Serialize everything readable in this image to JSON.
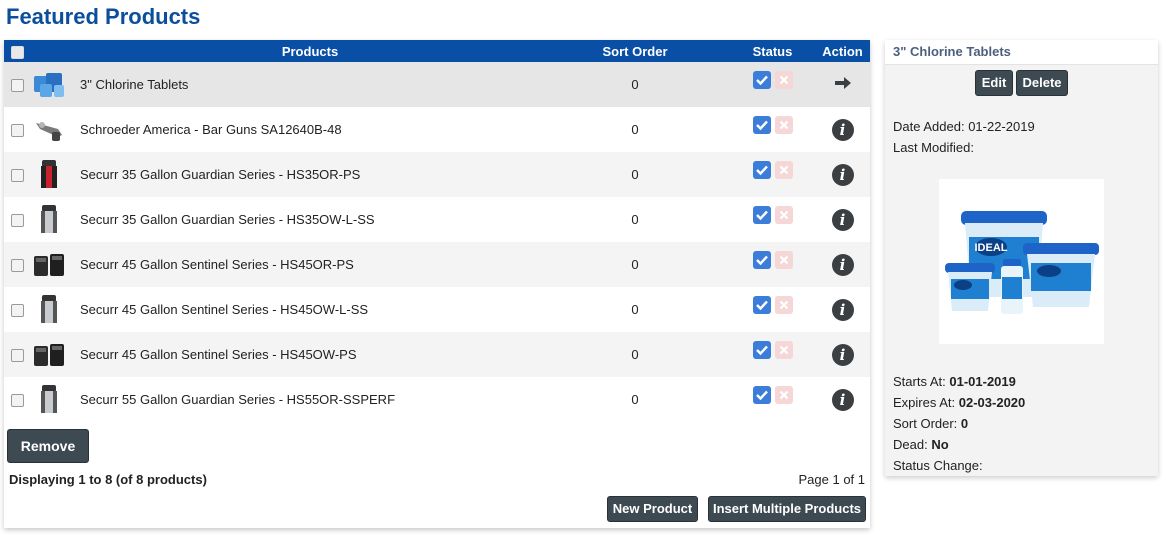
{
  "page": {
    "title": "Featured Products"
  },
  "table": {
    "headers": {
      "products": "Products",
      "sort_order": "Sort Order",
      "status": "Status",
      "action": "Action"
    },
    "rows": [
      {
        "name": "3\" Chlorine Tablets",
        "sort_order": "0",
        "image": "chlorine-tablets-image",
        "action_icon": "arrow-right-icon"
      },
      {
        "name": "Schroeder America - Bar Guns SA12640B-48",
        "sort_order": "0",
        "image": "bar-gun-image",
        "action_icon": "info-icon"
      },
      {
        "name": "Securr 35 Gallon Guardian Series - HS35OR-PS",
        "sort_order": "0",
        "image": "trash-can-red-image",
        "action_icon": "info-icon"
      },
      {
        "name": "Securr 35 Gallon Guardian Series - HS35OW-L-SS",
        "sort_order": "0",
        "image": "trash-can-steel-image",
        "action_icon": "info-icon"
      },
      {
        "name": "Securr 45 Gallon Sentinel Series - HS45OR-PS",
        "sort_order": "0",
        "image": "trash-cans-black-image",
        "action_icon": "info-icon"
      },
      {
        "name": "Securr 45 Gallon Sentinel Series - HS45OW-L-SS",
        "sort_order": "0",
        "image": "trash-can-steel-image",
        "action_icon": "info-icon"
      },
      {
        "name": "Securr 45 Gallon Sentinel Series - HS45OW-PS",
        "sort_order": "0",
        "image": "trash-cans-black-image",
        "action_icon": "info-icon"
      },
      {
        "name": "Securr 55 Gallon Guardian Series - HS55OR-SSPERF",
        "sort_order": "0",
        "image": "trash-can-steel-image",
        "action_icon": "info-icon"
      }
    ]
  },
  "buttons": {
    "remove": "Remove",
    "new_product": "New Product",
    "insert_multiple": "Insert Multiple Products",
    "edit": "Edit",
    "delete": "Delete"
  },
  "footer": {
    "displaying": "Displaying 1 to 8 (of 8 products)",
    "page_of": "Page 1 of 1"
  },
  "detail": {
    "title": "3\" Chlorine Tablets",
    "date_added_label": "Date Added:",
    "date_added": "01-22-2019",
    "last_modified_label": "Last Modified:",
    "starts_at_label": "Starts At:",
    "starts_at": "01-01-2019",
    "expires_at_label": "Expires At:",
    "expires_at": "02-03-2020",
    "sort_order_label": "Sort Order:",
    "sort_order": "0",
    "dead_label": "Dead:",
    "dead": "No",
    "status_change_label": "Status Change:",
    "image_brand": "IDEAL"
  },
  "colors": {
    "title": "#0b4f9c",
    "table_header": "#0a4fa6",
    "status_on": "#3b7dd8",
    "status_off": "#f6d7d7",
    "button": "#3d4a52"
  }
}
